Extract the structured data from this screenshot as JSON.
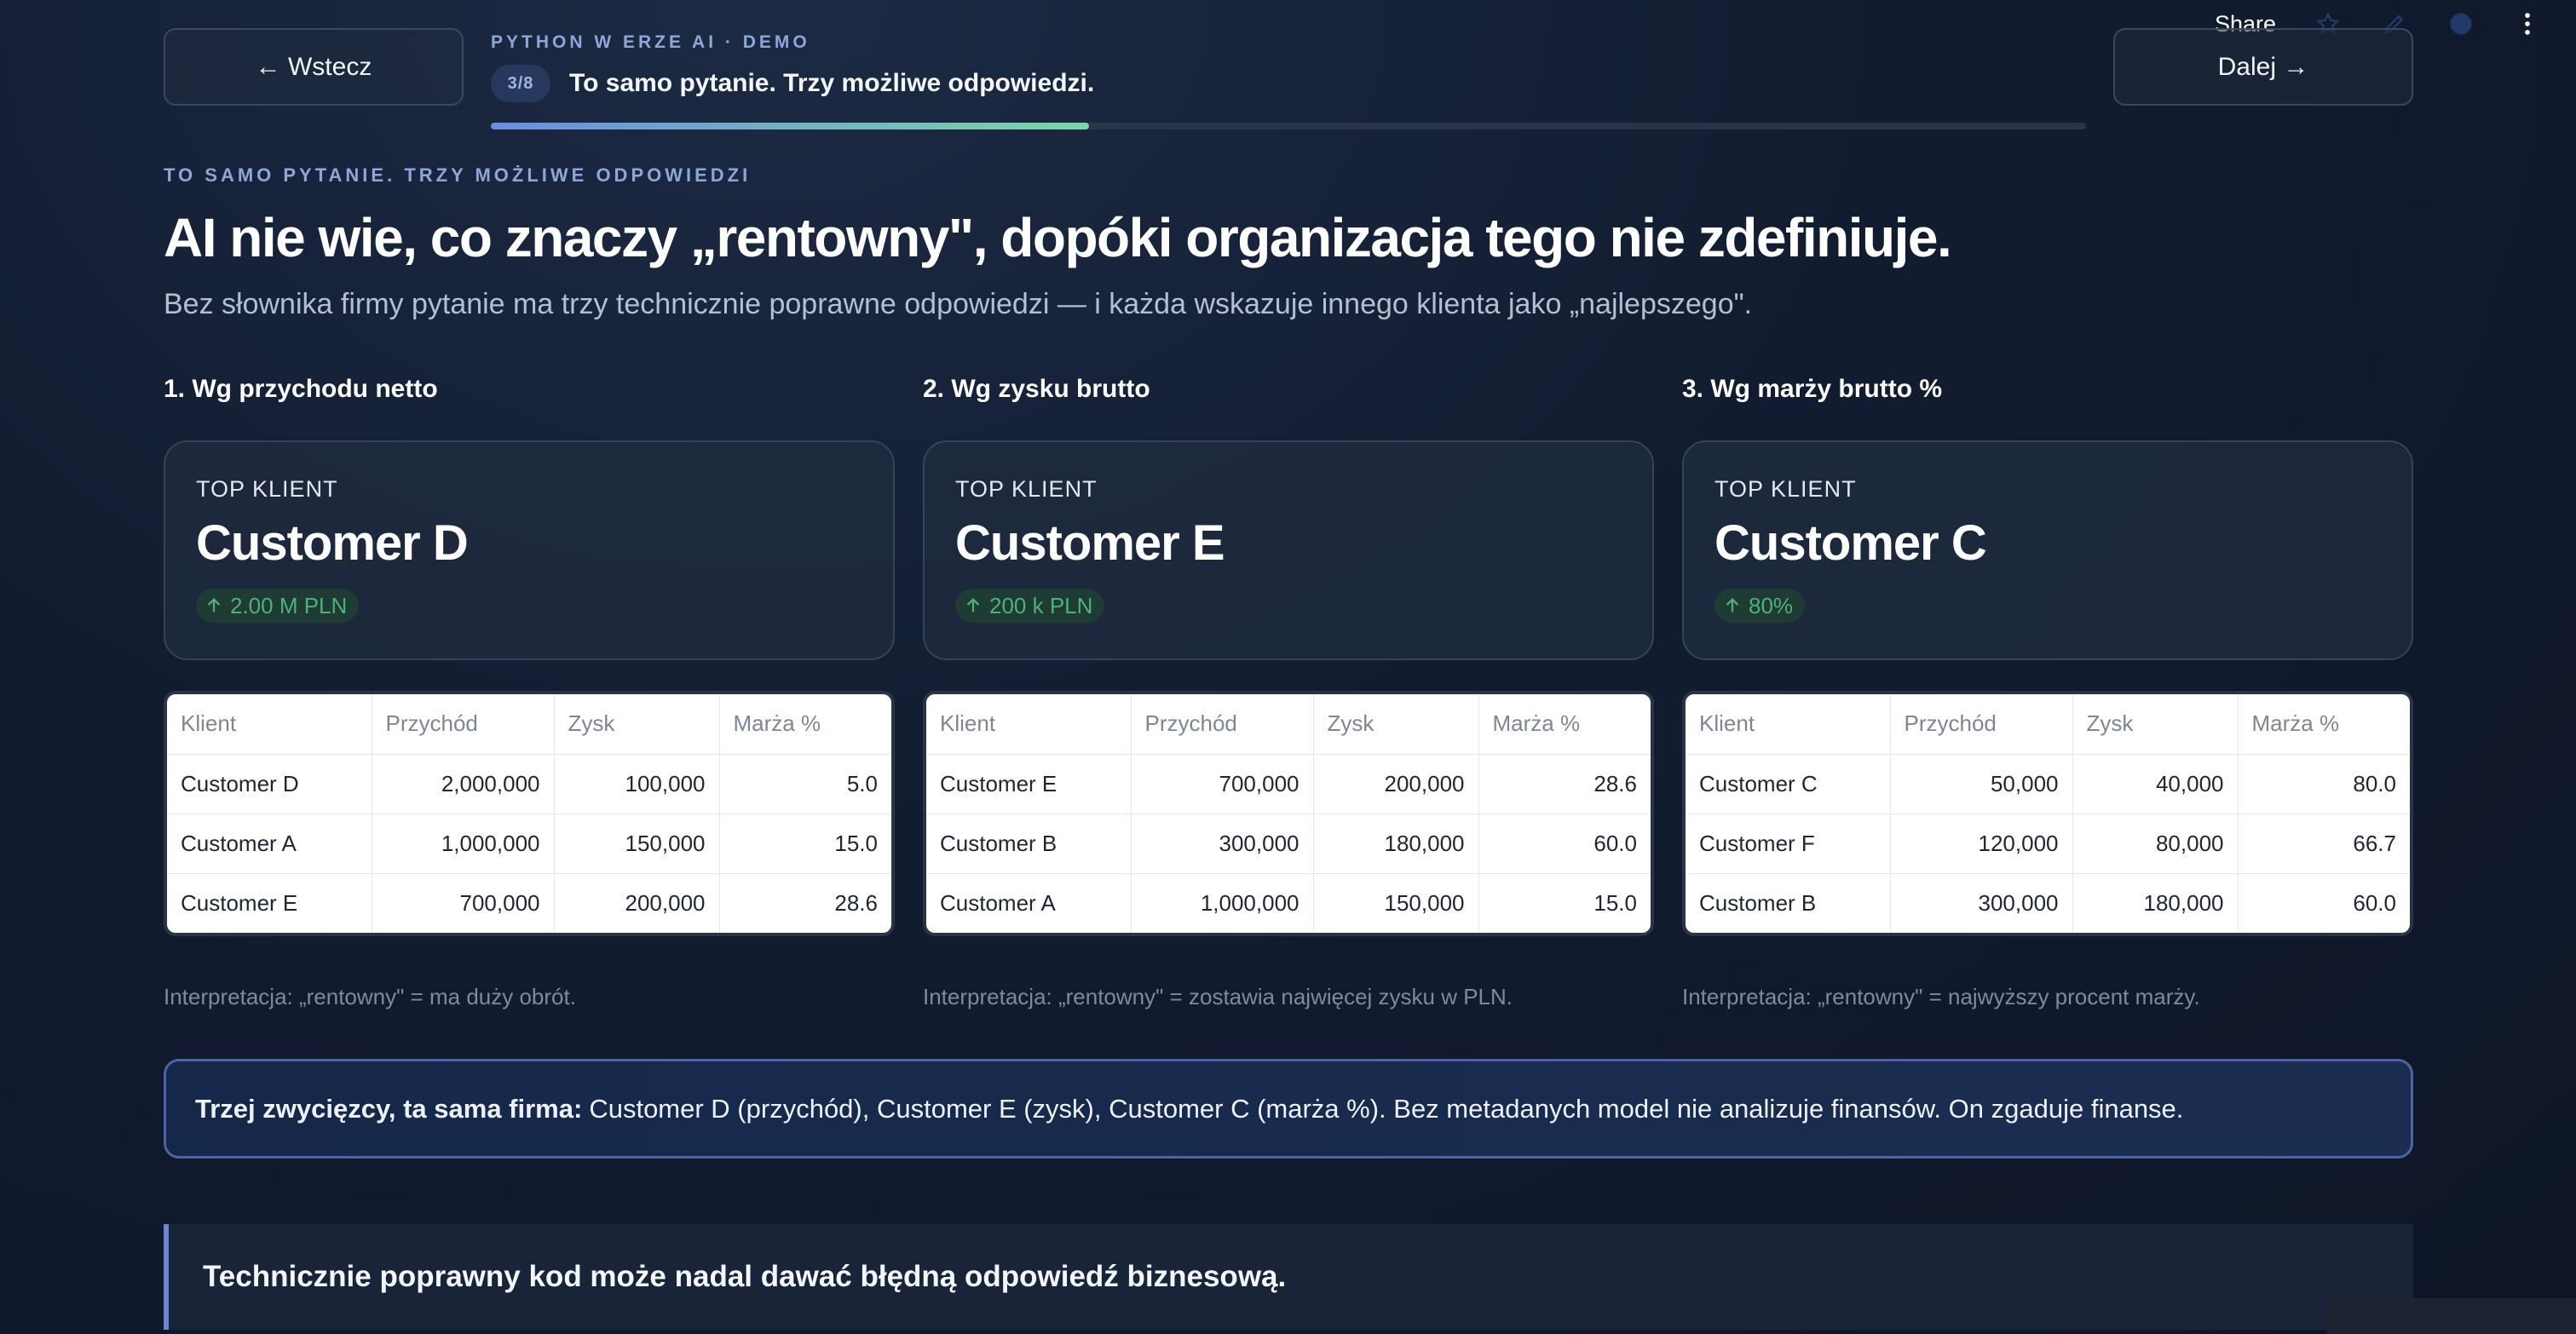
{
  "toolbar": {
    "share_label": "Share",
    "icons": [
      "star-icon",
      "edit-icon",
      "github-icon",
      "more-vertical-icon"
    ]
  },
  "nav": {
    "back_label": "← Wstecz",
    "next_label": "Dalej →"
  },
  "header": {
    "kicker": "PYTHON W ERZE AI · DEMO",
    "step_badge": "3/8",
    "step_title": "To samo pytanie. Trzy możliwe odpowiedzi.",
    "progress": 0.375
  },
  "intro": {
    "eyebrow": "TO SAMO PYTANIE. TRZY MOŻLIWE ODPOWIEDZI",
    "headline": "AI nie wie, co znaczy „rentowny\", dopóki organizacja tego nie zdefiniuje.",
    "lead": "Bez słownika firmy pytanie ma trzy technicznie poprawne odpowiedzi — i każda wskazuje innego klienta jako „najlepszego\"."
  },
  "table_headers": [
    "Klient",
    "Przychód",
    "Zysk",
    "Marża %"
  ],
  "columns": [
    {
      "heading": "1. Wg przychodu netto",
      "metric_label": "TOP KLIENT",
      "metric_value": "Customer D",
      "delta": "2.00 M PLN",
      "rows": [
        [
          "Customer D",
          "2,000,000",
          "100,000",
          "5.0"
        ],
        [
          "Customer A",
          "1,000,000",
          "150,000",
          "15.0"
        ],
        [
          "Customer E",
          "700,000",
          "200,000",
          "28.6"
        ]
      ],
      "interpretation": "Interpretacja: „rentowny\" = ma duży obrót."
    },
    {
      "heading": "2. Wg zysku brutto",
      "metric_label": "TOP KLIENT",
      "metric_value": "Customer E",
      "delta": "200 k PLN",
      "rows": [
        [
          "Customer E",
          "700,000",
          "200,000",
          "28.6"
        ],
        [
          "Customer B",
          "300,000",
          "180,000",
          "60.0"
        ],
        [
          "Customer A",
          "1,000,000",
          "150,000",
          "15.0"
        ]
      ],
      "interpretation": "Interpretacja: „rentowny\" = zostawia najwięcej zysku w PLN."
    },
    {
      "heading": "3. Wg marży brutto %",
      "metric_label": "TOP KLIENT",
      "metric_value": "Customer C",
      "delta": "80%",
      "rows": [
        [
          "Customer C",
          "50,000",
          "40,000",
          "80.0"
        ],
        [
          "Customer F",
          "120,000",
          "80,000",
          "66.7"
        ],
        [
          "Customer B",
          "300,000",
          "180,000",
          "60.0"
        ]
      ],
      "interpretation": "Interpretacja: „rentowny\" = najwyższy procent marży."
    }
  ],
  "callout": {
    "bold": "Trzej zwycięzcy, ta sama firma:",
    "text": "Customer D (przychód), Customer E (zysk), Customer C (marża %). Bez metadanych model nie analizuje finansów. On zgaduje finanse."
  },
  "quote": "Technicznie poprawny kod może nadal dawać błędną odpowiedź biznesową.",
  "colors": {
    "accent": "#8ea6d8",
    "positive": "#4fb07c",
    "border": "#4a64a6"
  }
}
